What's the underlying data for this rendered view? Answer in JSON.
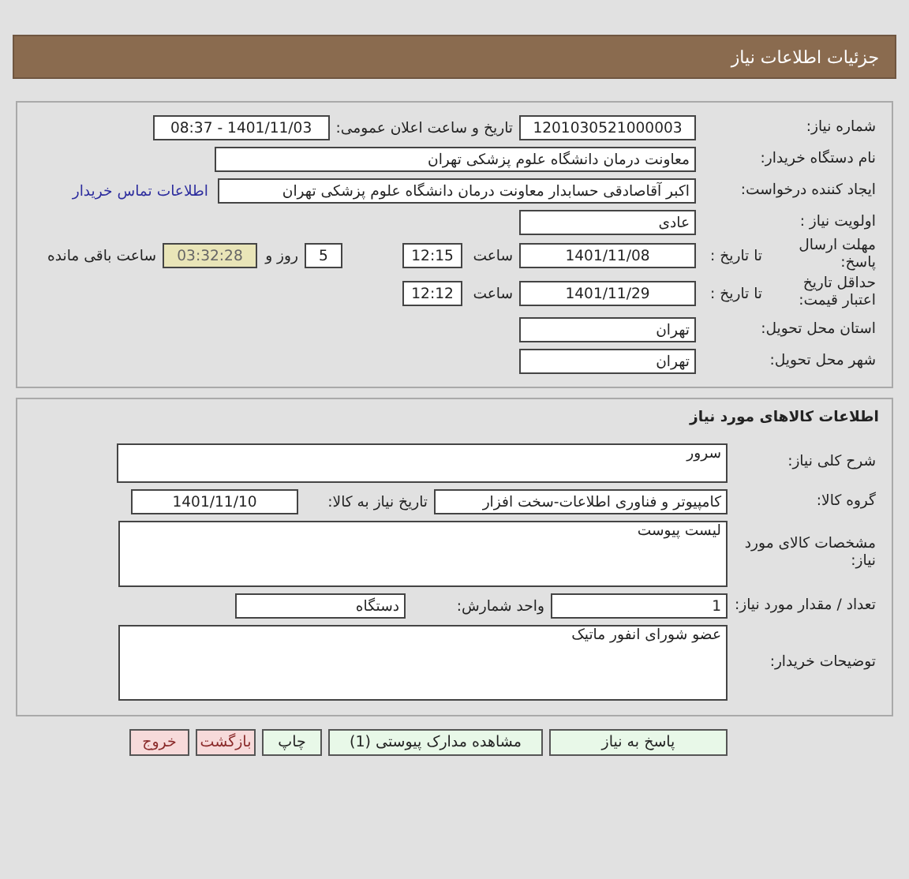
{
  "header": {
    "title": "جزئیات اطلاعات نیاز"
  },
  "need_info": {
    "need_number": {
      "label": "شماره نیاز:",
      "value": "1201030521000003"
    },
    "announce": {
      "label": "تاریخ و ساعت اعلان عمومی:",
      "value": "1401/11/03 - 08:37"
    },
    "buyer": {
      "label": "نام دستگاه خریدار:",
      "value": "معاونت درمان دانشگاه علوم پزشکی تهران"
    },
    "creator": {
      "label": "ایجاد کننده درخواست:",
      "value": "اکبر آقاصادقی حسابدار معاونت درمان دانشگاه علوم پزشکی تهران",
      "link": "اطلاعات تماس خریدار"
    },
    "priority": {
      "label": "اولویت نیاز :",
      "value": "عادی"
    },
    "deadline": {
      "label": "مهلت ارسال پاسخ:",
      "to_date_label": "تا تاریخ :",
      "date": "1401/11/08",
      "time_label": "ساعت",
      "time": "12:15",
      "days": "5",
      "days_label": "روز و",
      "remaining": "03:32:28",
      "remaining_label": "ساعت باقی مانده"
    },
    "validity": {
      "label": "حداقل تاریخ اعتبار قیمت:",
      "to_date_label": "تا تاریخ :",
      "date": "1401/11/29",
      "time_label": "ساعت",
      "time": "12:12"
    },
    "province": {
      "label": "استان محل تحویل:",
      "value": "تهران"
    },
    "city": {
      "label": "شهر محل تحویل:",
      "value": "تهران"
    }
  },
  "goods": {
    "title": "اطلاعات کالاهای مورد نیاز",
    "description": {
      "label": "شرح کلی نیاز:",
      "value": "سرور"
    },
    "group": {
      "label": "گروه کالا:",
      "value": "کامپیوتر و فناوری اطلاعات-سخت افزار",
      "date_label": "تاریخ نیاز به کالا:",
      "date": "1401/11/10"
    },
    "specs": {
      "label": "مشخصات کالای مورد نیاز:",
      "value": "لیست  پیوست"
    },
    "quantity": {
      "label": "تعداد / مقدار مورد نیاز:",
      "value": "1",
      "unit_label": "واحد شمارش:",
      "unit": "دستگاه"
    },
    "notes": {
      "label": "توضیحات خریدار:",
      "value": "عضو شورای انفور ماتیک"
    }
  },
  "buttons": [
    {
      "label": "پاسخ به نیاز",
      "kind": "action"
    },
    {
      "label": "مشاهده مدارک پیوستی (1)",
      "kind": "action"
    },
    {
      "label": "چاپ",
      "kind": "action"
    },
    {
      "label": "بازگشت",
      "kind": "exit"
    },
    {
      "label": "خروج",
      "kind": "exit"
    }
  ]
}
